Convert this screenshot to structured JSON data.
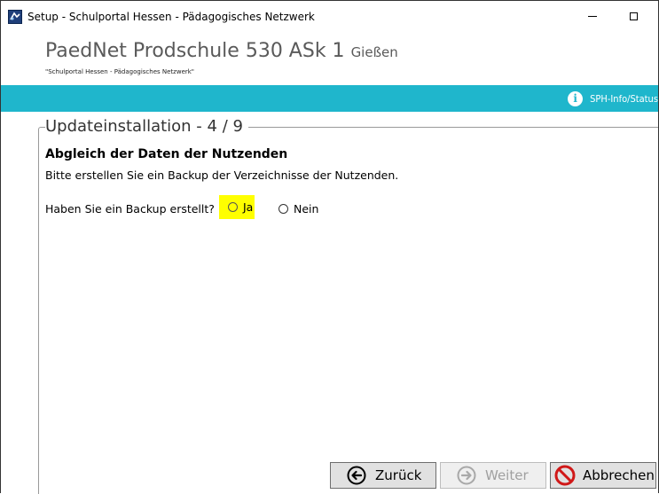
{
  "window": {
    "title": "Setup - Schulportal Hessen - Pädagogisches Netzwerk"
  },
  "header": {
    "school_name": "PaedNet Prodschule 530 ASk 1",
    "school_city": "Gießen",
    "subtitle": "\"Schulportal Hessen - Pädagogisches Netzwerk\""
  },
  "info_bar": {
    "color": "#1fb6cc",
    "link_label": "SPH-Info/Status",
    "icon": "info-icon"
  },
  "section": {
    "title": "Updateinstallation - 4 / 9",
    "heading": "Abgleich der Daten der Nutzenden",
    "description": "Bitte erstellen Sie ein Backup der Verzeichnisse der Nutzenden.",
    "question": "Haben Sie ein Backup erstellt?",
    "options": [
      {
        "label": "Ja",
        "selected": false,
        "highlighted": true,
        "highlight_color": "#ffff00"
      },
      {
        "label": "Nein",
        "selected": false
      }
    ]
  },
  "buttons": {
    "back": {
      "label": "Zurück",
      "icon": "arrow-left-icon",
      "enabled": true
    },
    "next": {
      "label": "Weiter",
      "icon": "arrow-right-icon",
      "enabled": false
    },
    "cancel": {
      "label": "Abbrechen",
      "icon": "no-entry-icon",
      "enabled": true
    }
  }
}
